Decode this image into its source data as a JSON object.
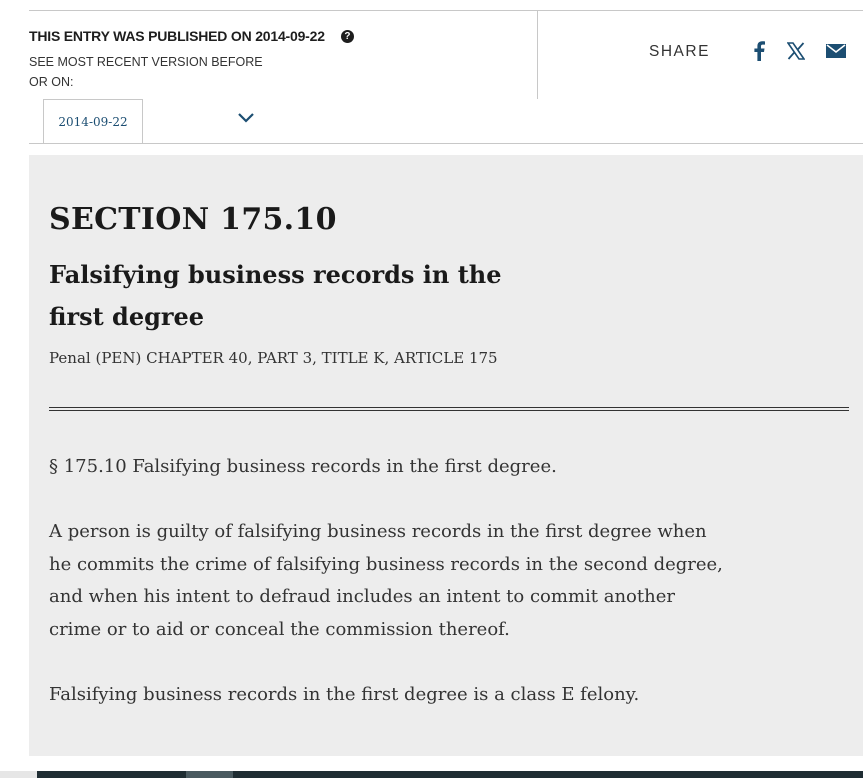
{
  "version_info": {
    "published_label": "THIS ENTRY WAS PUBLISHED ON 2014-09-22",
    "help_icon_glyph": "?",
    "recent_version_label": "SEE MOST RECENT VERSION BEFORE OR ON:",
    "selected_date": "2014-09-22"
  },
  "share": {
    "label": "SHARE",
    "icons": [
      "facebook-icon",
      "x-icon",
      "mail-icon"
    ],
    "icon_color": "#1c4e72"
  },
  "section": {
    "heading": "SECTION 175.10",
    "title": "Falsifying business records in the first degree",
    "citation": "Penal (PEN) CHAPTER 40, PART 3, TITLE K, ARTICLE 175"
  },
  "body": {
    "paragraphs": [
      "§ 175.10 Falsifying business records in the first degree.",
      "A person is guilty of falsifying business records in the first degree when he commits the crime of falsifying business records in the second degree, and when his intent to defraud includes an intent to commit another crime or to aid or conceal the commission thereof.",
      "Falsifying business records in the first degree is a class E felony."
    ]
  },
  "colors": {
    "content_background": "#ededed",
    "link_blue": "#1c4e72"
  }
}
